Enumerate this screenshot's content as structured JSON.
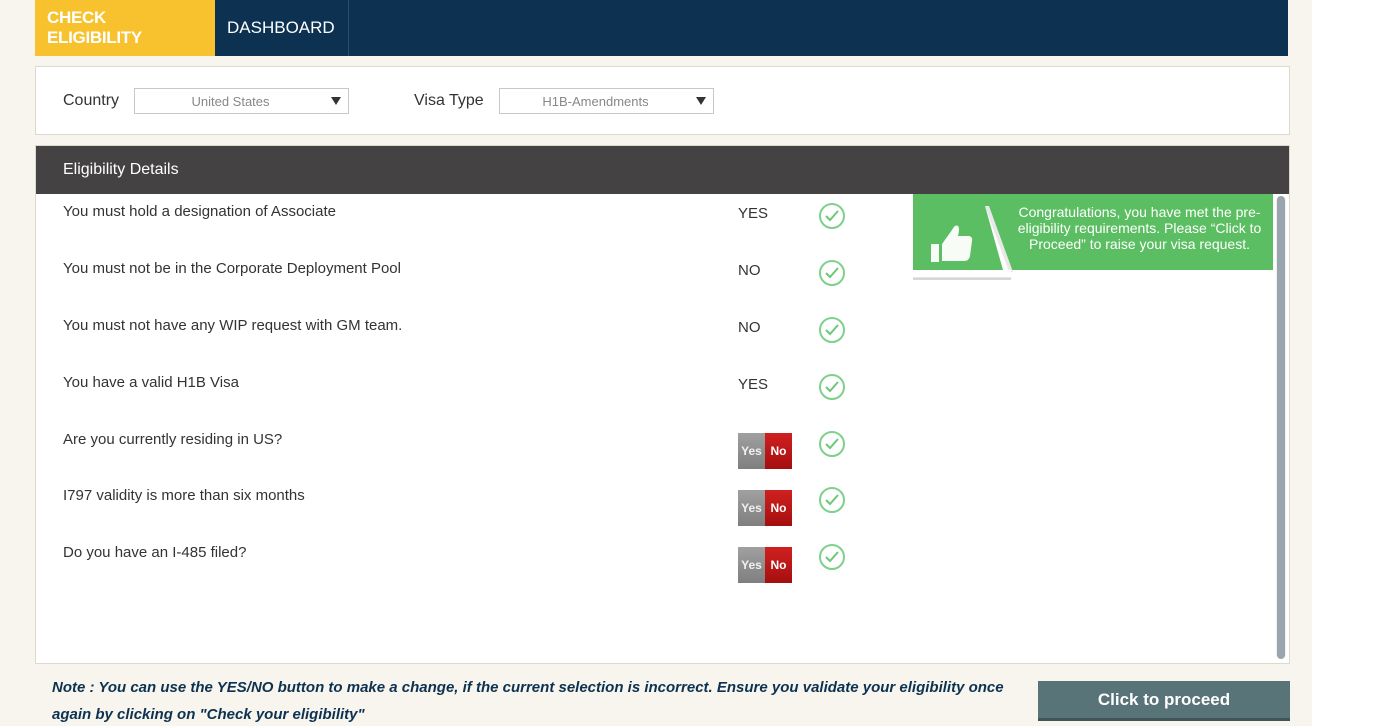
{
  "nav": {
    "tabs": [
      {
        "label": "CHECK ELIGIBILITY",
        "active": true
      },
      {
        "label": "DASHBOARD",
        "active": false
      }
    ]
  },
  "filters": {
    "country_label": "Country",
    "country_value": "United States",
    "visa_label": "Visa Type",
    "visa_value": "H1B-Amendments"
  },
  "eligibility": {
    "header": "Eligibility Details",
    "rows": [
      {
        "question": "You must hold a designation of Associate",
        "answer": "YES",
        "type": "text"
      },
      {
        "question": "You must not be in the Corporate Deployment Pool",
        "answer": "NO",
        "type": "text"
      },
      {
        "question": "You must not have any WIP request with GM team.",
        "answer": "NO",
        "type": "text"
      },
      {
        "question": "You have a valid H1B Visa",
        "answer": "YES",
        "type": "text"
      },
      {
        "question": "Are you currently residing in US?",
        "answer": "No",
        "type": "toggle"
      },
      {
        "question": "I797 validity is more than six months",
        "answer": "No",
        "type": "toggle"
      },
      {
        "question": "Do you have an I-485 filed?",
        "answer": "No",
        "type": "toggle"
      }
    ],
    "toggle_yes": "Yes",
    "toggle_no": "No"
  },
  "congrats": {
    "message": "Congratulations, you have met the pre-eligibility requirements. Please “Click to Proceed” to raise your visa request."
  },
  "footer": {
    "note": "Note : You can use the YES/NO button to make a change, if the current selection is incorrect. Ensure you validate your eligibility once again by clicking on \"Check your eligibility\"",
    "proceed_label": "Click to proceed"
  },
  "colors": {
    "nav_bg": "#0d3251",
    "active_tab": "#f7c22d",
    "header_bg": "#444242",
    "success_green": "#5cbe62",
    "no_red": "#c01818",
    "proceed_bg": "#587479"
  }
}
